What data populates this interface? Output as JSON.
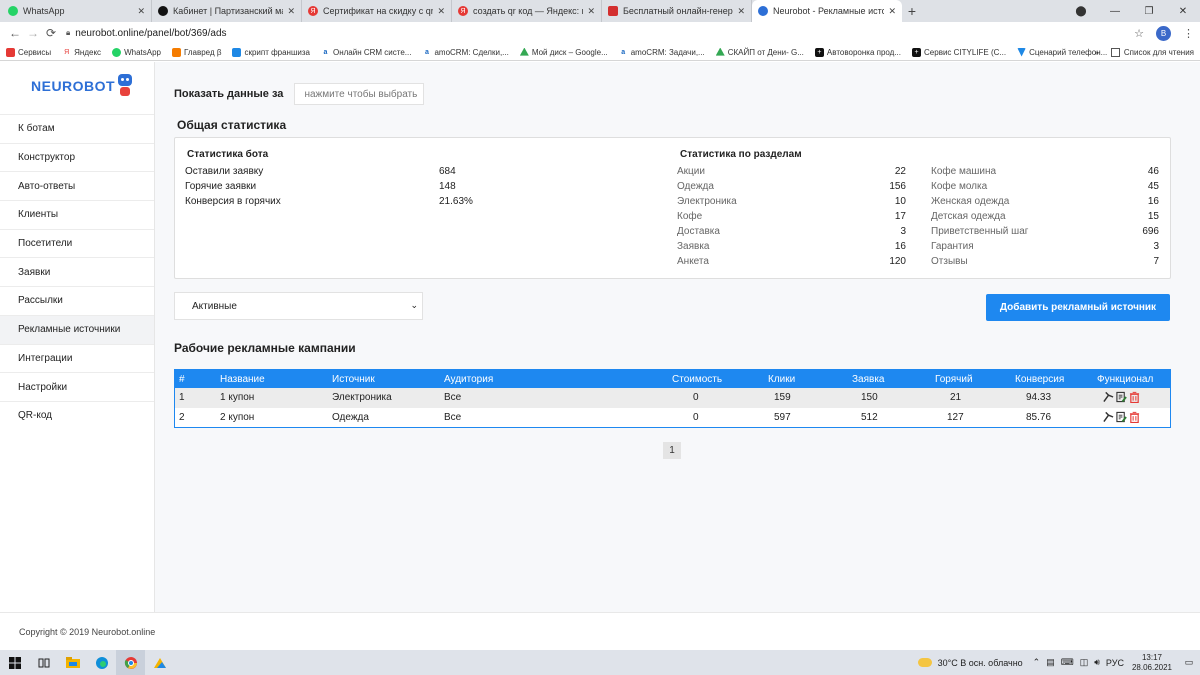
{
  "browser": {
    "tabs": [
      {
        "title": "WhatsApp",
        "color": "#25d366"
      },
      {
        "title": "Кабинет | Партизанский маркет",
        "color": "#111111"
      },
      {
        "title": "Сертификат на скидку с qr кодо",
        "color": "#e53935"
      },
      {
        "title": "создать qr код — Яндекс: нашл",
        "color": "#e53935"
      },
      {
        "title": "Бесплатный онлайн-генератор",
        "color": "#d32f2f"
      },
      {
        "title": "Neurobot - Рекламные источни",
        "color": "#2d6fd6",
        "active": true
      }
    ],
    "url": "neurobot.online/panel/bot/369/ads",
    "profile_initial": "B",
    "bookmarks": [
      {
        "label": "Сервисы",
        "color": "#e53935"
      },
      {
        "label": "Яндекс",
        "color": "#e53935"
      },
      {
        "label": "WhatsApp",
        "color": "#25d366"
      },
      {
        "label": "Главред β",
        "color": "#f57c00"
      },
      {
        "label": "скрипт франшиза",
        "color": "#1e88e5"
      },
      {
        "label": "Онлайн CRM систе...",
        "color": "#1565c0"
      },
      {
        "label": "amoCRM: Сделки,...",
        "color": "#1565c0"
      },
      {
        "label": "Мой диск – Google...",
        "color": "#34a853"
      },
      {
        "label": "amoCRM: Задачи,...",
        "color": "#1565c0"
      },
      {
        "label": "СКАЙП от Дени- G...",
        "color": "#34a853"
      },
      {
        "label": "Автоворонка прод...",
        "color": "#111111"
      },
      {
        "label": "Сервис CITYLIFE (С...",
        "color": "#111111"
      },
      {
        "label": "Сценарий телефон...",
        "color": "#1e88e5"
      }
    ],
    "bookmarks_overflow": "»",
    "reading_list": "Список для чтения"
  },
  "sidebar": {
    "logo": "NEUROBOT",
    "items": [
      {
        "label": "К ботам"
      },
      {
        "label": "Конструктор"
      },
      {
        "label": "Авто-ответы"
      },
      {
        "label": "Клиенты"
      },
      {
        "label": "Посетители"
      },
      {
        "label": "Заявки"
      },
      {
        "label": "Рассылки"
      },
      {
        "label": "Рекламные источники",
        "active": true
      },
      {
        "label": "Интеграции"
      },
      {
        "label": "Настройки"
      },
      {
        "label": "QR-код"
      }
    ]
  },
  "main": {
    "period_label": "Показать данные за",
    "period_placeholder": "нажмите чтобы выбрать",
    "general_title": "Общая статистика",
    "bot_stats": {
      "title": "Статистика бота",
      "rows": [
        {
          "label": "Оставили заявку",
          "value": "684"
        },
        {
          "label": "Горячие заявки",
          "value": "148"
        },
        {
          "label": "Конверсия в горячих",
          "value": "21.63%"
        }
      ]
    },
    "section_stats": {
      "title": "Статистика по разделам",
      "col1": [
        {
          "label": "Акции",
          "value": "22"
        },
        {
          "label": "Одежда",
          "value": "156"
        },
        {
          "label": "Электроника",
          "value": "10"
        },
        {
          "label": "Кофе",
          "value": "17"
        },
        {
          "label": "Доставка",
          "value": "3"
        },
        {
          "label": "Заявка",
          "value": "16"
        },
        {
          "label": "Анкета",
          "value": "120"
        }
      ],
      "col2": [
        {
          "label": "Кофе машина",
          "value": "46"
        },
        {
          "label": "Кофе молка",
          "value": "45"
        },
        {
          "label": "Женская одежда",
          "value": "16"
        },
        {
          "label": "Детская одежда",
          "value": "15"
        },
        {
          "label": "Приветственный шаг",
          "value": "696"
        },
        {
          "label": "Гарантия",
          "value": "3"
        },
        {
          "label": "Отзывы",
          "value": "7"
        }
      ]
    },
    "filter_value": "Активные",
    "add_button": "Добавить рекламный источник",
    "campaigns_title": "Рабочие рекламные кампании",
    "table": {
      "headers": [
        "#",
        "Название",
        "Источник",
        "Аудитория",
        "Стоимость",
        "Клики",
        "Заявка",
        "Горячий",
        "Конверсия",
        "Функционал"
      ],
      "rows": [
        [
          "1",
          "1 купон",
          "Электроника",
          "Все",
          "0",
          "159",
          "150",
          "21",
          "94.33"
        ],
        [
          "2",
          "2 купон",
          "Одежда",
          "Все",
          "0",
          "597",
          "512",
          "127",
          "85.76"
        ]
      ]
    },
    "page": "1"
  },
  "footer": {
    "copyright": "Copyright © 2019 Neurobot.online"
  },
  "taskbar": {
    "weather": "30°C  В осн. облачно",
    "lang": "РУС",
    "time": "13:17",
    "date": "28.06.2021"
  },
  "colors": {
    "accent": "#1e88f0",
    "logo": "#2d6fd6",
    "delete": "#e53935"
  }
}
